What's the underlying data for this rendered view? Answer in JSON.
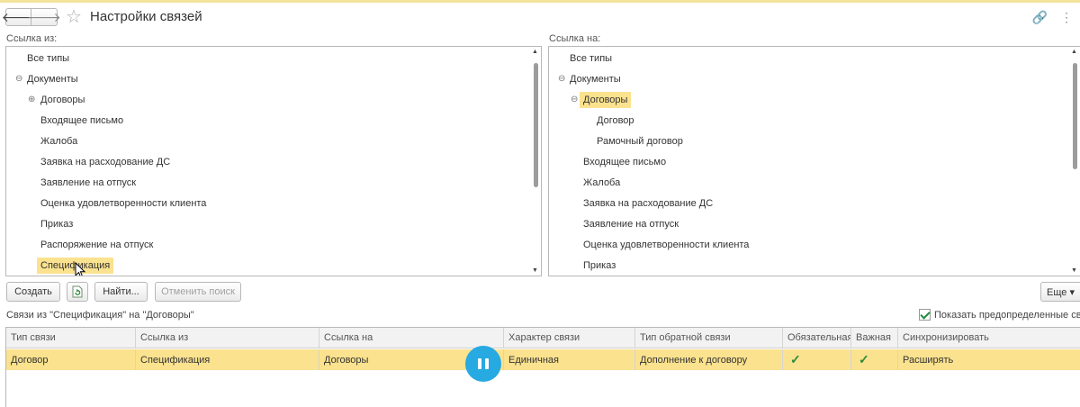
{
  "window": {
    "title": "Настройки связей"
  },
  "left_pane": {
    "label": "Ссылка из:",
    "items": [
      {
        "label": "Все типы"
      },
      {
        "label": "Документы"
      },
      {
        "label": "Договоры"
      },
      {
        "label": "Входящее письмо"
      },
      {
        "label": "Жалоба"
      },
      {
        "label": "Заявка на расходование ДС"
      },
      {
        "label": "Заявление на отпуск"
      },
      {
        "label": "Оценка удовлетворенности клиента"
      },
      {
        "label": "Приказ"
      },
      {
        "label": "Распоряжение на отпуск"
      },
      {
        "label": "Спецификация"
      }
    ]
  },
  "right_pane": {
    "label": "Ссылка на:",
    "items": [
      {
        "label": "Все типы"
      },
      {
        "label": "Документы"
      },
      {
        "label": "Договоры"
      },
      {
        "label": "Договор"
      },
      {
        "label": "Рамочный договор"
      },
      {
        "label": "Входящее письмо"
      },
      {
        "label": "Жалоба"
      },
      {
        "label": "Заявка на расходование ДС"
      },
      {
        "label": "Заявление на отпуск"
      },
      {
        "label": "Оценка удовлетворенности клиента"
      },
      {
        "label": "Приказ"
      }
    ]
  },
  "toolbar": {
    "create_label": "Создать",
    "find_label": "Найти...",
    "cancel_search_label": "Отменить поиск",
    "more_label": "Еще ▾"
  },
  "links": {
    "caption": "Связи из \"Спецификация\" на \"Договоры\"",
    "show_predefined_label": "Показать предопределенные связи",
    "columns": [
      "Тип связи",
      "Ссылка из",
      "Ссылка на",
      "Характер связи",
      "Тип обратной связи",
      "Обязательная",
      "Важная",
      "Синхронизировать"
    ],
    "rows": [
      {
        "type": "Договор",
        "from": "Спецификация",
        "to": "Договоры",
        "character": "Единичная",
        "reverse_type": "Дополнение к договору",
        "mandatory": "✓",
        "important": "✓",
        "sync": "Расширять"
      }
    ]
  },
  "colors": {
    "selection": "#fbe28e",
    "accent": "#27a9e1",
    "check": "#2e8b3e"
  }
}
